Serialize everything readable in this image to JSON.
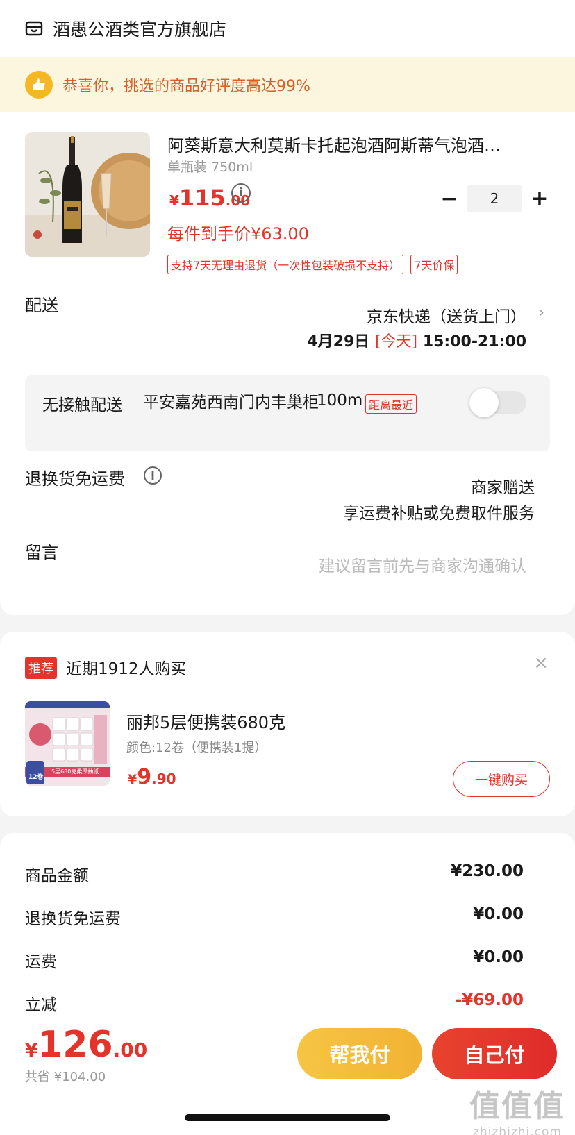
{
  "store": {
    "name": "酒愚公酒类官方旗舰店",
    "icon": "store-icon"
  },
  "praise": {
    "text": "恭喜你，挑选的商品好评度高达99%",
    "icon": "thumbs-up-icon"
  },
  "product": {
    "title": "阿葵斯意大利莫斯卡托起泡酒阿斯蒂气泡酒…",
    "spec": "单瓶装 750ml",
    "price_currency": "¥",
    "price_int": "115",
    "price_dec": ".00",
    "net_price": "每件到手价¥63.00",
    "quantity": "2",
    "minus_label": "−",
    "plus_label": "+",
    "tags": [
      "支持7天无理由退货（一次性包装破损不支持）",
      "7天价保"
    ]
  },
  "delivery": {
    "label": "配送",
    "method": "京东快递（送货上门）",
    "chevron": "›",
    "date": "4月29日",
    "today": "[今天]",
    "time": "15:00-21:00"
  },
  "contactless": {
    "label": "无接触配送",
    "place": "平安嘉苑西南门内丰巢柜",
    "distance": "100m",
    "badge": "距离最近",
    "enabled": false
  },
  "return_service": {
    "label": "退换货免运费",
    "line1": "商家赠送",
    "line2": "享运费补贴或免费取件服务"
  },
  "message": {
    "label": "留言",
    "placeholder": "建议留言前先与商家沟通确认"
  },
  "recommend": {
    "badge": "推荐",
    "title": "近期1912人购买",
    "close": "×",
    "name": "丽邦5层便携装680克",
    "spec": "颜色:12卷（便携装1提）",
    "price_currency": "¥",
    "price_int": "9",
    "price_dec": ".90",
    "buy_label": "一键购买",
    "img_caption": "5层680克柔厚抽纸",
    "img_count": "12卷"
  },
  "summary": [
    {
      "label": "商品金额",
      "value": "¥230.00",
      "red": false
    },
    {
      "label": "退换货免运费",
      "value": "¥0.00",
      "red": false
    },
    {
      "label": "运费",
      "value": "¥0.00",
      "red": false
    },
    {
      "label": "立减",
      "value": "-¥69.00",
      "red": true
    }
  ],
  "footer": {
    "total_currency": "¥",
    "total_int": "126",
    "total_dec": ".00",
    "saved": "共省 ¥104.00",
    "help_pay": "帮我付",
    "self_pay": "自己付"
  },
  "watermark": {
    "big": "值值值",
    "small": "zhizhizhi.com"
  },
  "colors": {
    "accent": "#e4332b",
    "gold": "#f2b233",
    "praise_bg": "#fdf6df"
  }
}
